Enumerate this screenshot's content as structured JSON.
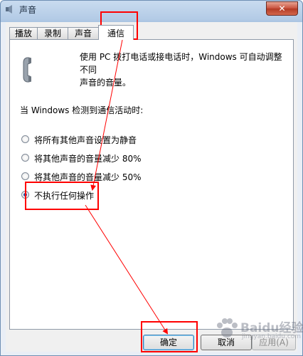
{
  "window": {
    "title": "声音",
    "close_glyph": "✕"
  },
  "tabs": [
    {
      "label": "播放",
      "active": false
    },
    {
      "label": "录制",
      "active": false
    },
    {
      "label": "声音",
      "active": false
    },
    {
      "label": "通信",
      "active": true
    }
  ],
  "panel": {
    "icon": "phone-handset-icon",
    "description_line1": "使用 PC 拨打电话或接电话时，Windows 可自动调整不同",
    "description_line2": "声音的音量。",
    "intro": "当 Windows 检测到通信活动时:",
    "options": [
      {
        "label": "将所有其他声音设置为静音",
        "selected": false
      },
      {
        "label": "将其他声音的音量减少 80%",
        "selected": false
      },
      {
        "label": "将其他声音的音量减少 50%",
        "selected": false
      },
      {
        "label": "不执行任何操作",
        "selected": true
      }
    ]
  },
  "buttons": {
    "ok": "确定",
    "cancel": "取消",
    "apply": "应用(A)"
  },
  "watermark": {
    "text": "Baidu经验",
    "sub": "jingyan.baidu.com"
  },
  "colors": {
    "annotation": "#ff0000",
    "radio_selected": "#2154a8",
    "default_button": "#3c7fb1"
  }
}
